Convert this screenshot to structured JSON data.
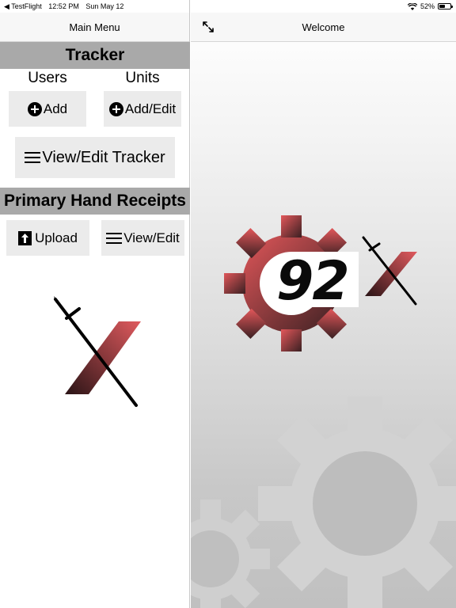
{
  "status_bar": {
    "back_app": "◀ TestFlight",
    "time": "12:52 PM",
    "date": "Sun May 12",
    "battery": "52%",
    "battery_level": 0.52
  },
  "master": {
    "nav_title": "Main Menu",
    "tracker": {
      "heading": "Tracker",
      "users_label": "Users",
      "units_label": "Units",
      "add_label": "Add",
      "add_edit_label": "Add/Edit",
      "view_edit_tracker_label": "View/Edit Tracker"
    },
    "hand_receipts": {
      "heading": "Primary Hand Receipts",
      "upload_label": "Upload",
      "view_edit_label": "View/Edit"
    }
  },
  "detail": {
    "nav_title": "Welcome",
    "logo_text": "92"
  },
  "colors": {
    "brand_red": "#d9534f",
    "brand_dark": "#2a1416",
    "section_gray": "#a9a9a9",
    "button_gray": "#ebebeb"
  },
  "icons": [
    "wifi-icon",
    "battery-icon",
    "plus-circle-icon",
    "menu-icon",
    "upload-icon",
    "expand-icon",
    "sword-icon",
    "gear-icon"
  ]
}
